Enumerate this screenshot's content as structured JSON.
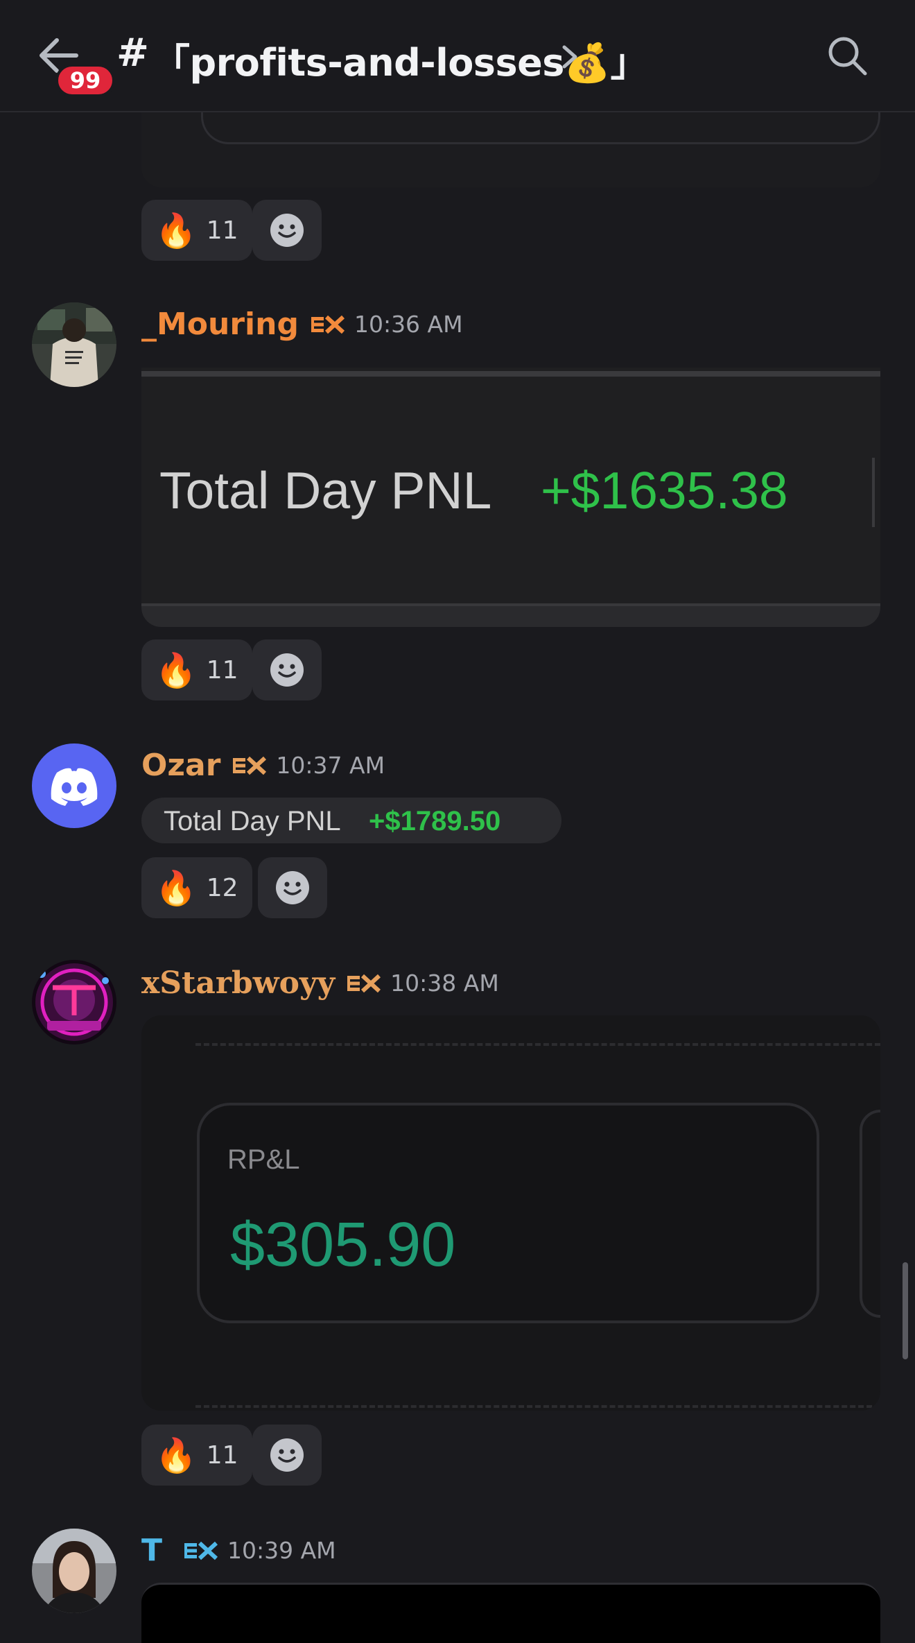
{
  "header": {
    "back_label": "Back",
    "unread_badge": "99",
    "hash": "#",
    "channel_name": "「profits-and-losses💰」",
    "search_label": "Search"
  },
  "colors": {
    "background": "#1a1a1e",
    "pnl_green": "#2fc14a",
    "rpl_green": "#1f9a73",
    "badge_red": "#e0263a",
    "username_orange": "#f28a3c",
    "username_gold": "#e6a05c",
    "username_blue": "#4fb8e8"
  },
  "top_reactions": {
    "emoji": "🔥",
    "count": "11"
  },
  "messages": [
    {
      "username": "_Mouring",
      "server_tag": "EX",
      "time": "10:36 AM",
      "embed": {
        "label": "Total Day PNL",
        "value": "+$1635.38"
      },
      "reactions": {
        "emoji": "🔥",
        "count": "11"
      }
    },
    {
      "username": "Ozar",
      "server_tag": "EX",
      "time": "10:37 AM",
      "embed": {
        "label": "Total Day PNL",
        "value": "+$1789.50"
      },
      "reactions": {
        "emoji": "🔥",
        "count": "12"
      }
    },
    {
      "username": "xStarbwoyy",
      "server_tag": "EX",
      "time": "10:38 AM",
      "embed": {
        "label": "RP&L",
        "value": "$305.90"
      },
      "reactions": {
        "emoji": "🔥",
        "count": "11"
      }
    },
    {
      "username": "T",
      "server_tag": "EX",
      "time": "10:39 AM"
    }
  ]
}
